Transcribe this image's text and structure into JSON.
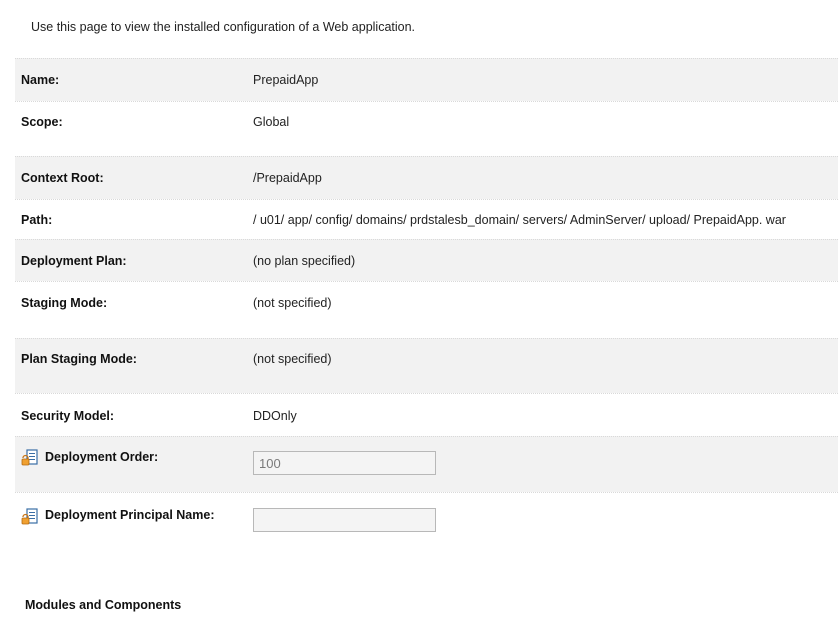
{
  "intro": "Use this page to view the installed configuration of a Web application.",
  "rows": [
    {
      "label": "Name:",
      "value": "PrepaidApp"
    },
    {
      "label": "Scope:",
      "value": "Global"
    },
    {
      "label": "Context Root:",
      "value": "/PrepaidApp"
    },
    {
      "label": "Path:",
      "value": "/ u01/ app/ config/ domains/ prdstalesb_domain/ servers/ AdminServer/ upload/ PrepaidApp. war"
    },
    {
      "label": "Deployment Plan:",
      "value": "(no plan specified)"
    },
    {
      "label": "Staging Mode:",
      "value": "(not specified)"
    },
    {
      "label": "Plan Staging Mode:",
      "value": "(not specified)"
    },
    {
      "label": "Security Model:",
      "value": "DDOnly"
    },
    {
      "label": "Deployment Order:",
      "value": "100"
    },
    {
      "label": "Deployment Principal Name:",
      "value": ""
    }
  ],
  "section_title": "Modules and Components",
  "icons": {
    "field_icon": "lock-edit-icon"
  }
}
